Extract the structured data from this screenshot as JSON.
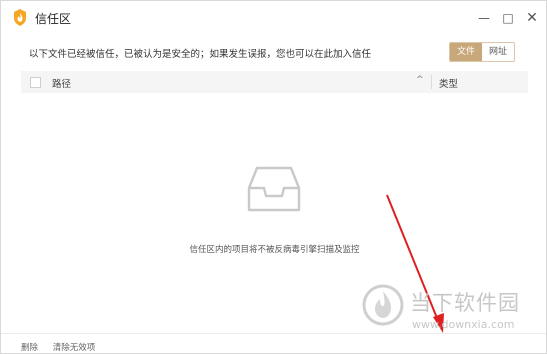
{
  "window": {
    "title": "信任区",
    "icons": {
      "app": "shield-flame-icon",
      "minimize": "minimize-icon",
      "maximize": "maximize-icon",
      "close": "close-icon"
    },
    "controls": {
      "minimize": "—",
      "maximize": "□",
      "close": "✕"
    }
  },
  "info": {
    "text": "以下文件已经被信任，已被认为是安全的；如果发生误报，您也可以在此加入信任"
  },
  "segmented": {
    "options": [
      "文件",
      "网址"
    ],
    "selected": "文件",
    "accent": "#c8a77a"
  },
  "table": {
    "columns": {
      "path": "路径",
      "type": "类型"
    },
    "sort_indicator": "^"
  },
  "empty_state": {
    "icon": "empty-tray-icon",
    "message": "信任区内的项目将不被反病毒引擎扫描及监控"
  },
  "footer": {
    "delete": "删除",
    "clear_invalid": "清除无效项"
  },
  "watermark": {
    "title": "当下软件园",
    "url": "www.downxia.com"
  },
  "annotation": {
    "arrow_color": "#e02020"
  }
}
